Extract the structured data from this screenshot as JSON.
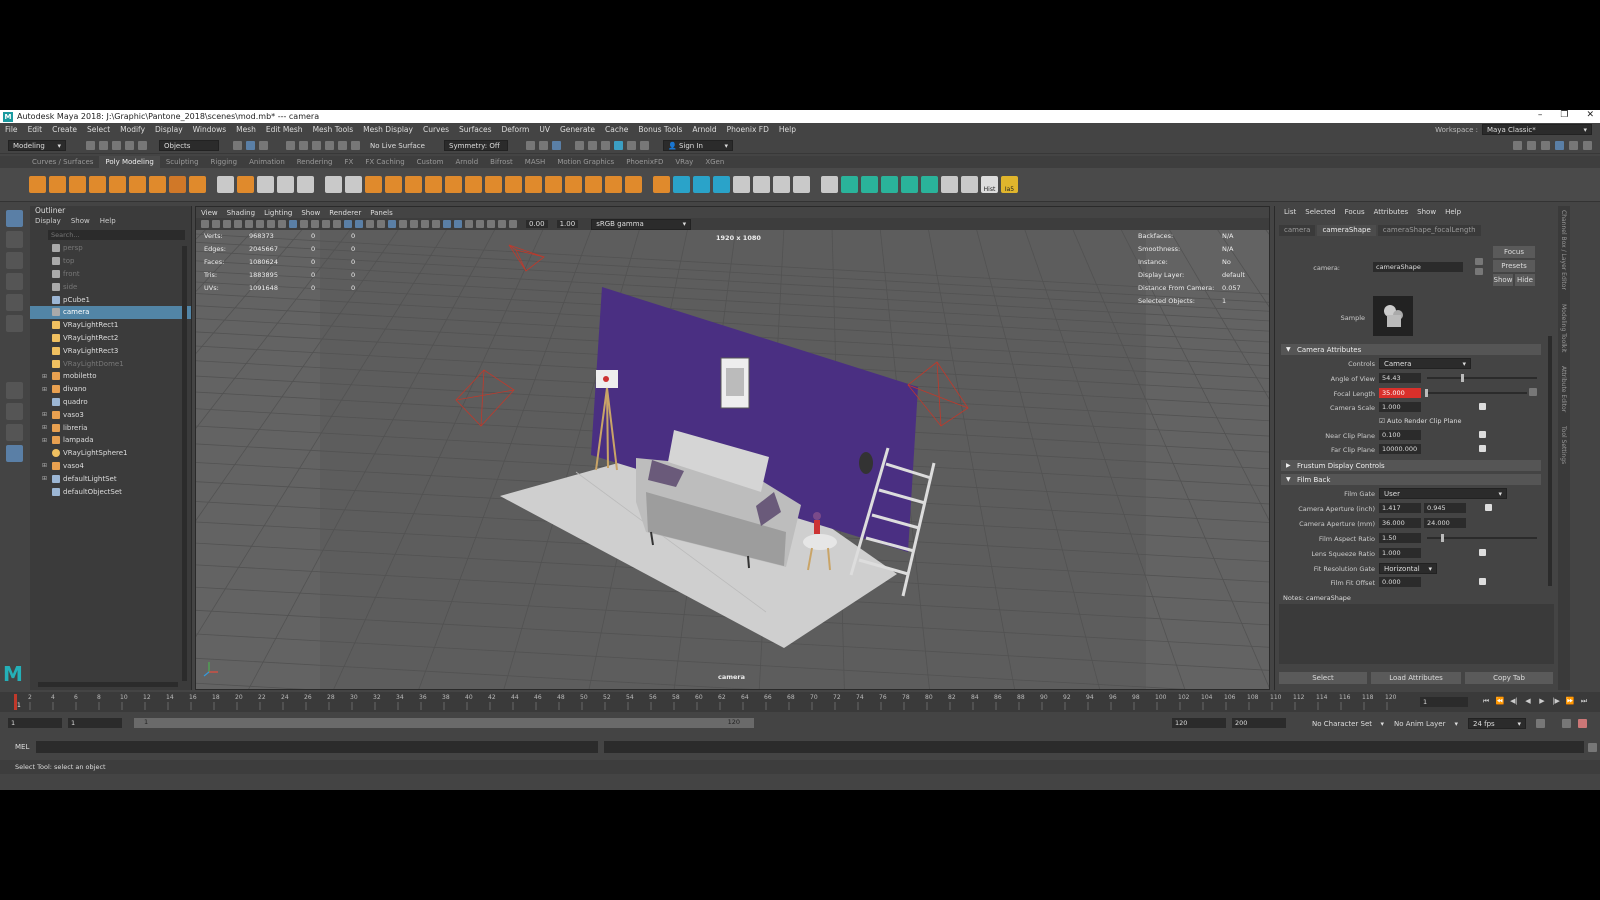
{
  "window": {
    "title": "Autodesk Maya 2018: J:\\Graphic\\Pantone_2018\\scenes\\mod.mb*  ---  camera",
    "logo": "M",
    "controls": {
      "minimize": "–",
      "maximize": "❐",
      "close": "✕"
    }
  },
  "menubar": {
    "items": [
      "File",
      "Edit",
      "Create",
      "Select",
      "Modify",
      "Display",
      "Windows",
      "Mesh",
      "Edit Mesh",
      "Mesh Tools",
      "Mesh Display",
      "Curves",
      "Surfaces",
      "Deform",
      "UV",
      "Generate",
      "Cache",
      "Bonus Tools",
      "Arnold",
      "Phoenix FD",
      "Help"
    ],
    "workspace_label": "Workspace :",
    "workspace_value": "Maya Classic*"
  },
  "statusline": {
    "mode": "Modeling",
    "objects": "Objects",
    "live_surface": "No Live Surface",
    "symmetry": "Symmetry: Off",
    "sign_in": "Sign In"
  },
  "shelf": {
    "tabs": [
      "Curves / Surfaces",
      "Poly Modeling",
      "Sculpting",
      "Rigging",
      "Animation",
      "Rendering",
      "FX",
      "FX Caching",
      "Custom",
      "Arnold",
      "Bifrost",
      "MASH",
      "Motion Graphics",
      "PhoenixFD",
      "VRay",
      "XGen"
    ],
    "active_tab": "Poly Modeling",
    "icon_labels": {
      "hist": "Hist",
      "ia": "Ia5"
    }
  },
  "outliner": {
    "title": "Outliner",
    "menu": [
      "Display",
      "Show",
      "Help"
    ],
    "search_placeholder": "Search...",
    "items": [
      {
        "label": "persp",
        "dim": true,
        "expand": false,
        "icon": "camera-icon"
      },
      {
        "label": "top",
        "dim": true,
        "expand": false,
        "icon": "camera-icon"
      },
      {
        "label": "front",
        "dim": true,
        "expand": false,
        "icon": "camera-icon"
      },
      {
        "label": "side",
        "dim": true,
        "expand": false,
        "icon": "camera-icon"
      },
      {
        "label": "pCube1",
        "dim": false,
        "expand": false,
        "icon": "transform-icon"
      },
      {
        "label": "camera",
        "dim": false,
        "expand": false,
        "icon": "camera-icon",
        "selected": true
      },
      {
        "label": "VRayLightRect1",
        "dim": false,
        "expand": false,
        "icon": "light-icon"
      },
      {
        "label": "VRayLightRect2",
        "dim": false,
        "expand": false,
        "icon": "light-icon"
      },
      {
        "label": "VRayLightRect3",
        "dim": false,
        "expand": false,
        "icon": "light-icon"
      },
      {
        "label": "VRayLightDome1",
        "dim": true,
        "expand": false,
        "icon": "light-icon"
      },
      {
        "label": "mobiletto",
        "dim": false,
        "expand": true,
        "icon": "group-icon"
      },
      {
        "label": "divano",
        "dim": false,
        "expand": true,
        "icon": "group-icon"
      },
      {
        "label": "quadro",
        "dim": false,
        "expand": false,
        "icon": "transform-icon"
      },
      {
        "label": "vaso3",
        "dim": false,
        "expand": true,
        "icon": "group-icon"
      },
      {
        "label": "libreria",
        "dim": false,
        "expand": true,
        "icon": "group-icon"
      },
      {
        "label": "lampada",
        "dim": false,
        "expand": true,
        "icon": "group-icon"
      },
      {
        "label": "VRayLightSphere1",
        "dim": false,
        "expand": false,
        "icon": "sphere-light-icon"
      },
      {
        "label": "vaso4",
        "dim": false,
        "expand": true,
        "icon": "group-icon"
      },
      {
        "label": "defaultLightSet",
        "dim": false,
        "expand": true,
        "icon": "set-icon"
      },
      {
        "label": "defaultObjectSet",
        "dim": false,
        "expand": false,
        "icon": "set-icon"
      }
    ]
  },
  "viewport": {
    "menu": [
      "View",
      "Shading",
      "Lighting",
      "Show",
      "Renderer",
      "Panels"
    ],
    "exposure": "0.00",
    "gamma": "1.00",
    "color_space": "sRGB gamma",
    "resolution": "1920 x 1080",
    "camera_label": "camera",
    "hud_left": [
      {
        "label": "Verts:",
        "value": "968373",
        "a": "0",
        "b": "0"
      },
      {
        "label": "Edges:",
        "value": "2045667",
        "a": "0",
        "b": "0"
      },
      {
        "label": "Faces:",
        "value": "1080624",
        "a": "0",
        "b": "0"
      },
      {
        "label": "Tris:",
        "value": "1883895",
        "a": "0",
        "b": "0"
      },
      {
        "label": "UVs:",
        "value": "1091648",
        "a": "0",
        "b": "0"
      }
    ],
    "hud_right": [
      {
        "label": "Backfaces:",
        "value": "N/A"
      },
      {
        "label": "Smoothness:",
        "value": "N/A"
      },
      {
        "label": "Instance:",
        "value": "No"
      },
      {
        "label": "Display Layer:",
        "value": "default"
      },
      {
        "label": "Distance From Camera:",
        "value": "0.057"
      },
      {
        "label": "Selected Objects:",
        "value": "1"
      }
    ],
    "wall_color": "#4a2f82"
  },
  "attribute_editor": {
    "menu": [
      "List",
      "Selected",
      "Focus",
      "Attributes",
      "Show",
      "Help"
    ],
    "tabs": [
      "camera",
      "cameraShape",
      "cameraShape_focalLength"
    ],
    "active_tab": "cameraShape",
    "node_label": "camera:",
    "node_value": "cameraShape",
    "focus_btn": "Focus",
    "presets_btn": "Presets",
    "show_btn": "Show",
    "hide_btn": "Hide",
    "sample_label": "Sample",
    "camera_attributes": {
      "title": "Camera Attributes",
      "controls_label": "Controls",
      "controls_value": "Camera",
      "angle_of_view_label": "Angle of View",
      "angle_of_view": "54.43",
      "focal_length_label": "Focal Length",
      "focal_length": "35.000",
      "camera_scale_label": "Camera Scale",
      "camera_scale": "1.000",
      "auto_render_clip_label": "Auto Render Clip Plane",
      "near_clip_label": "Near Clip Plane",
      "near_clip": "0.100",
      "far_clip_label": "Far Clip Plane",
      "far_clip": "10000.000"
    },
    "frustum_section": "Frustum Display Controls",
    "film_back": {
      "title": "Film Back",
      "film_gate_label": "Film Gate",
      "film_gate_value": "User",
      "aperture_inch_label": "Camera Aperture (inch)",
      "aperture_inch_x": "1.417",
      "aperture_inch_y": "0.945",
      "aperture_mm_label": "Camera Aperture (mm)",
      "aperture_mm_x": "36.000",
      "aperture_mm_y": "24.000",
      "aspect_label": "Film Aspect Ratio",
      "aspect": "1.50",
      "squeeze_label": "Lens Squeeze Ratio",
      "squeeze": "1.000",
      "fit_gate_label": "Fit Resolution Gate",
      "fit_gate_value": "Horizontal",
      "fit_offset_label": "Film Fit Offset",
      "fit_offset": "0.000"
    },
    "notes_label": "Notes:  cameraShape",
    "bottom_buttons": [
      "Select",
      "Load Attributes",
      "Copy Tab"
    ]
  },
  "right_tabs": [
    "Channel Box / Layer Editor",
    "Modeling Toolkit",
    "Attribute Editor",
    "Tool Settings"
  ],
  "timeline": {
    "ticks": [
      "2",
      "4",
      "6",
      "8",
      "10",
      "12",
      "14",
      "16",
      "18",
      "20",
      "22",
      "24",
      "26",
      "28",
      "30",
      "32",
      "34",
      "36",
      "38",
      "40",
      "42",
      "44",
      "46",
      "48",
      "50",
      "52",
      "54",
      "56",
      "58",
      "60",
      "62",
      "64",
      "66",
      "68",
      "70",
      "72",
      "74",
      "76",
      "78",
      "80",
      "82",
      "84",
      "86",
      "88",
      "90",
      "92",
      "94",
      "96",
      "98",
      "100",
      "102",
      "104",
      "106",
      "108",
      "110",
      "112",
      "114",
      "116",
      "118",
      "120"
    ],
    "current_frame": "1",
    "current_field": "1"
  },
  "range": {
    "start": "1",
    "start2": "1",
    "bar_start": "1",
    "bar_end": "120",
    "end": "120",
    "end2": "200",
    "character_set": "No Character Set",
    "anim_layer": "No Anim Layer",
    "fps": "24 fps"
  },
  "command": {
    "label": "MEL"
  },
  "help_line": "Select Tool: select an object"
}
